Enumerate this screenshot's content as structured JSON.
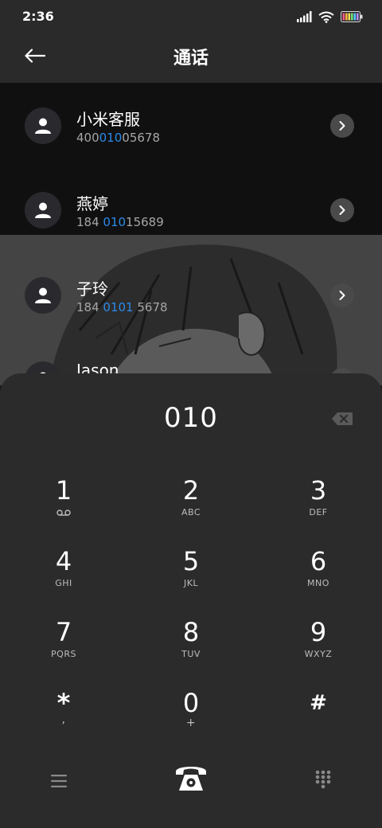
{
  "status": {
    "time": "2:36"
  },
  "header": {
    "title": "通话"
  },
  "contacts": [
    {
      "name": "小米客服",
      "num_before": "400",
      "num_match": "010",
      "num_after": "05678"
    },
    {
      "name": "燕婷",
      "num_before": "184 ",
      "num_match": "010",
      "num_after": "15689"
    },
    {
      "name": "子玲",
      "num_before": "184 ",
      "num_match": "0101",
      "num_after": " 5678"
    },
    {
      "name": "Jason",
      "num_before": "",
      "num_match": "",
      "num_after": ""
    }
  ],
  "dialer": {
    "display": "010",
    "keys": [
      {
        "digit": "1",
        "sub": "voicemail-icon"
      },
      {
        "digit": "2",
        "sub": "ABC"
      },
      {
        "digit": "3",
        "sub": "DEF"
      },
      {
        "digit": "4",
        "sub": "GHI"
      },
      {
        "digit": "5",
        "sub": "JKL"
      },
      {
        "digit": "6",
        "sub": "MNO"
      },
      {
        "digit": "7",
        "sub": "PQRS"
      },
      {
        "digit": "8",
        "sub": "TUV"
      },
      {
        "digit": "9",
        "sub": "WXYZ"
      },
      {
        "digit": "*",
        "sub": ","
      },
      {
        "digit": "0",
        "sub": "+"
      },
      {
        "digit": "#",
        "sub": ""
      }
    ]
  },
  "colors": {
    "accent": "#2b8ae8",
    "dialpad_bg": "#2b2b2b",
    "list_bg": "#101010"
  }
}
